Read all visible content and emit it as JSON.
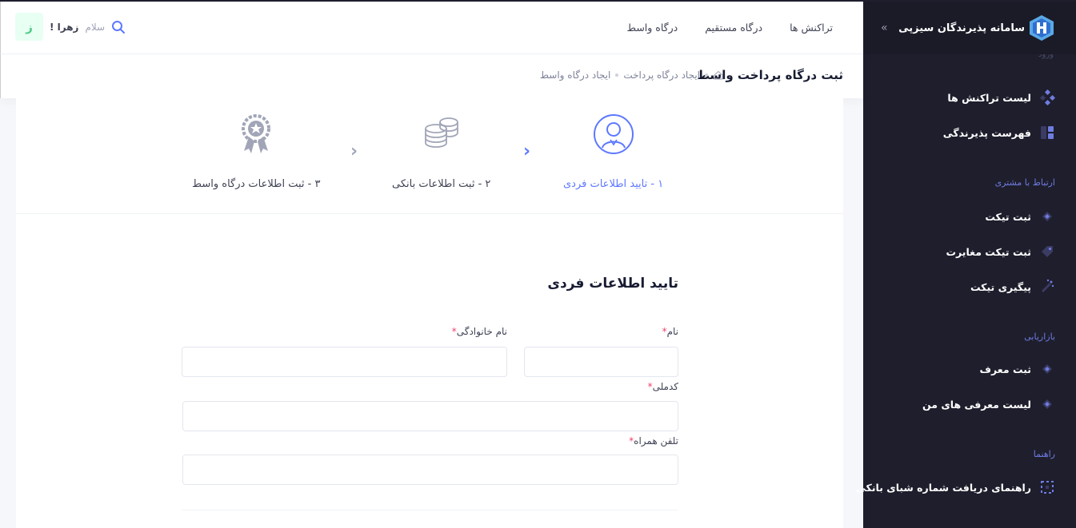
{
  "sidebar": {
    "brand_title": "سامانه پذیرندگان سیزپی",
    "toggle": "»",
    "cut_label": "ورود",
    "items": [
      {
        "label": "لیست تراکنش ها",
        "icon": "diamond-grid-icon"
      },
      {
        "label": "فهرست پذیرندگی",
        "icon": "layout-blocks-icon"
      },
      {
        "label": "ثبت تیکت",
        "icon": "ticket-icon"
      },
      {
        "label": "ثبت تیکت مغایرت",
        "icon": "tag-icon"
      },
      {
        "label": "پیگیری تیکت",
        "icon": "wand-icon"
      },
      {
        "label": "ثبت معرف",
        "icon": "ticket-icon"
      },
      {
        "label": "لیست معرفی های من",
        "icon": "ticket-icon"
      },
      {
        "label": "راهنمای دریافت شماره شبای بانکی",
        "icon": "dotted-square-icon"
      }
    ],
    "sections": {
      "customer": "ارتباط با مشتری",
      "marketing": "بازاریابی",
      "guide": "راهنما"
    }
  },
  "header": {
    "nav": [
      "تراکنش ها",
      "درگاه مستقیم",
      "درگاه واسط"
    ],
    "greeting": "سلام",
    "user_name": "زهرا !",
    "avatar_letter": "ز"
  },
  "subheader": {
    "title": "ثبت درگاه پرداخت واسط",
    "breadcrumb": [
      "ایجاد درگاه پرداخت",
      "ایجاد درگاه واسط"
    ]
  },
  "stepper": {
    "steps": [
      {
        "label": "۱ - تایید اطلاعات فردی",
        "active": true
      },
      {
        "label": "۲ - ثبت اطلاعات بانکی",
        "active": false
      },
      {
        "label": "۳ - ثبت اطلاعات درگاه واسط",
        "active": false
      }
    ],
    "chevron": "‹"
  },
  "form": {
    "title": "تایید اطلاعات فردی",
    "first_name_label": "نام",
    "last_name_label": "نام خانوادگی",
    "national_code_label": "کدملی",
    "mobile_label": "تلفن همراه",
    "required_mark": "*",
    "first_name_value": "",
    "last_name_value": "",
    "national_code_value": "",
    "mobile_value": ""
  },
  "colors": {
    "sidebar_bg": "#1e1e2d",
    "accent": "#5d78ff",
    "section_label": "#6f7ce0",
    "avatar_text": "#50cd89",
    "required": "#f1416c"
  }
}
